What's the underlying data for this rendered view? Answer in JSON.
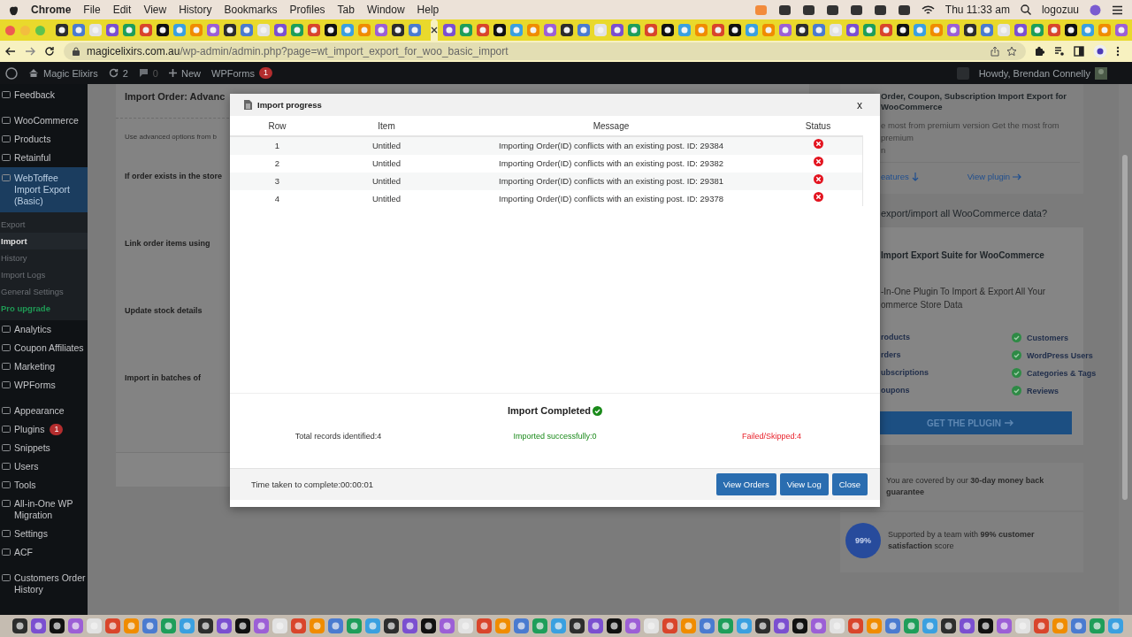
{
  "menu_bar": {
    "app": "Chrome",
    "menus": [
      "File",
      "Edit",
      "View",
      "History",
      "Bookmarks",
      "Profiles",
      "Tab",
      "Window",
      "Help"
    ],
    "clock": "Thu 11:33 am",
    "user": "logozuu"
  },
  "address_bar": {
    "domain": "magicelixirs.com.au",
    "path": "/wp-admin/admin.php?page=wt_import_export_for_woo_basic_import"
  },
  "admin_bar": {
    "site": "Magic Elixirs",
    "updates": "2",
    "comments": "0",
    "new": "New",
    "wpforms": "WPForms",
    "wpforms_badge": "1",
    "greeting": "Howdy, Brendan Connelly"
  },
  "sidebar": {
    "groups": [
      [
        {
          "label": "Feedback",
          "selected": false
        }
      ],
      [
        {
          "label": "WooCommerce",
          "selected": false
        },
        {
          "label": "Products",
          "selected": false
        },
        {
          "label": "Retainful",
          "selected": false
        },
        {
          "label": "WebToffee Import Export (Basic)",
          "selected": true,
          "children": [
            {
              "label": "Export",
              "selected": false,
              "kind": "link"
            },
            {
              "label": "Import",
              "selected": true,
              "kind": "link"
            },
            {
              "label": "History",
              "selected": false,
              "kind": "link"
            },
            {
              "label": "Import Logs",
              "selected": false,
              "kind": "link"
            },
            {
              "label": "General Settings",
              "selected": false,
              "kind": "link"
            },
            {
              "label": "Pro upgrade",
              "selected": false,
              "kind": "upgrade"
            }
          ]
        },
        {
          "label": "Analytics",
          "selected": false
        },
        {
          "label": "Coupon Affiliates",
          "selected": false
        },
        {
          "label": "Marketing",
          "selected": false
        },
        {
          "label": "WPForms",
          "selected": false
        }
      ],
      [
        {
          "label": "Appearance",
          "selected": false
        },
        {
          "label": "Plugins",
          "selected": false,
          "badge": "1"
        },
        {
          "label": "Snippets",
          "selected": false
        },
        {
          "label": "Users",
          "selected": false
        },
        {
          "label": "Tools",
          "selected": false
        },
        {
          "label": "All-in-One WP Migration",
          "selected": false
        },
        {
          "label": "Settings",
          "selected": false
        },
        {
          "label": "ACF",
          "selected": false
        }
      ],
      [
        {
          "label": "Customers Order History",
          "selected": false
        }
      ]
    ]
  },
  "page": {
    "title": "Import Order: Advanc",
    "intro": "Use advanced options from b",
    "fields": [
      "If order exists in the store",
      "Link order items using",
      "Update stock details",
      "Import in batches of"
    ]
  },
  "promo": {
    "plugin_title": "Order, Coupon, Subscription Import Export for WooCommerce",
    "plugin_desc": [
      "e most from premium version Get the most from premium",
      "n"
    ],
    "features_link": "eatures",
    "view_plugin": "View plugin",
    "question": "export/import all WooCommerce data?",
    "suite_title": "Import Export Suite for WooCommerce",
    "suite_desc": [
      "-In-One Plugin To Import & Export All Your",
      "ommerce Store Data"
    ],
    "features_left": [
      "roducts",
      "rders",
      "ubscriptions",
      "oupons"
    ],
    "features_right": [
      {
        "label": "Customers",
        "checked": true
      },
      {
        "label": "WordPress Users",
        "checked": true
      },
      {
        "label": "Categories & Tags",
        "checked": true
      },
      {
        "label": "Reviews",
        "checked": true
      }
    ],
    "cta": "GET THE PLUGIN",
    "guarantee": "You are covered by our **30-day money back guarantee**",
    "support": "Supported by a team with **99% customer satisfaction** score",
    "support_badge": "99%"
  },
  "modal": {
    "title": "Import progress",
    "close": "x",
    "columns": [
      "Row",
      "Item",
      "Message",
      "Status"
    ],
    "rows": [
      {
        "row": "1",
        "item": "Untitled",
        "message": "Importing Order(ID) conflicts with an existing post. ID: 29384",
        "kind": "failed"
      },
      {
        "row": "2",
        "item": "Untitled",
        "message": "Importing Order(ID) conflicts with an existing post. ID: 29382",
        "kind": "failed"
      },
      {
        "row": "3",
        "item": "Untitled",
        "message": "Importing Order(ID) conflicts with an existing post. ID: 29381",
        "kind": "failed"
      },
      {
        "row": "4",
        "item": "Untitled",
        "message": "Importing Order(ID) conflicts with an existing post. ID: 29378",
        "kind": "failed"
      }
    ],
    "summary_title": "Import Completed",
    "stats": [
      {
        "label": "Total records identified:4",
        "kind": "total"
      },
      {
        "label": "Imported successfully:0",
        "kind": "success"
      },
      {
        "label": "Failed/Skipped:4",
        "kind": "failed"
      }
    ],
    "time": "Time taken to complete:00:00:01",
    "buttons": [
      "View Orders",
      "View Log",
      "Close"
    ]
  }
}
